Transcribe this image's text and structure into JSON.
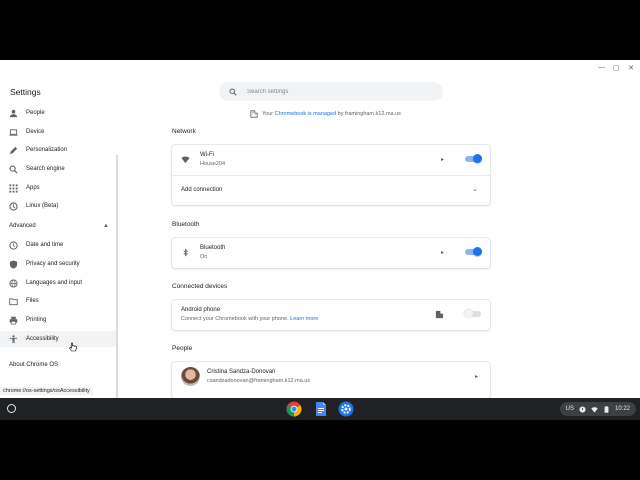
{
  "app_title": "Settings",
  "search": {
    "placeholder": "Search settings"
  },
  "managed": {
    "prefix": "Your",
    "link": "Chromebook is managed",
    "suffix": "by framingham.k12.ma.us"
  },
  "sidebar": {
    "items": [
      {
        "label": "People",
        "icon": "person-icon"
      },
      {
        "label": "Device",
        "icon": "laptop-icon"
      },
      {
        "label": "Personalization",
        "icon": "pencil-icon"
      },
      {
        "label": "Search engine",
        "icon": "search-icon"
      },
      {
        "label": "Apps",
        "icon": "apps-grid-icon"
      },
      {
        "label": "Linux (Beta)",
        "icon": "linux-icon"
      }
    ],
    "advanced_label": "Advanced",
    "advanced_items": [
      {
        "label": "Date and time",
        "icon": "clock-icon"
      },
      {
        "label": "Privacy and security",
        "icon": "shield-icon"
      },
      {
        "label": "Languages and input",
        "icon": "globe-icon"
      },
      {
        "label": "Files",
        "icon": "folder-icon"
      },
      {
        "label": "Printing",
        "icon": "printer-icon"
      },
      {
        "label": "Accessibility",
        "icon": "accessibility-icon",
        "active": true
      }
    ],
    "about": "About Chrome OS"
  },
  "network": {
    "title": "Network",
    "wifi": {
      "label": "Wi-Fi",
      "network": "House204",
      "enabled": true
    },
    "add_connection": "Add connection"
  },
  "bluetooth": {
    "title": "Bluetooth",
    "row": {
      "label": "Bluetooth",
      "status": "On",
      "enabled": true
    }
  },
  "connected_devices": {
    "title": "Connected devices",
    "android": {
      "label": "Android phone",
      "desc": "Connect your Chromebook with your phone.",
      "link": "Learn more",
      "enabled": false
    }
  },
  "people": {
    "title": "People",
    "name": "Cristina Sandza-Donovan",
    "email": "csandzadonovan@framingham.k12.ma.us"
  },
  "status_url": "chrome://os-settings/osAccessibility",
  "shelf": {
    "apps": [
      "chrome-icon",
      "docs-icon",
      "settings-app-icon"
    ],
    "tray": {
      "locale": "US",
      "time": "10:22"
    }
  },
  "colors": {
    "accent": "#1a73e8",
    "shelf": "#202124"
  }
}
